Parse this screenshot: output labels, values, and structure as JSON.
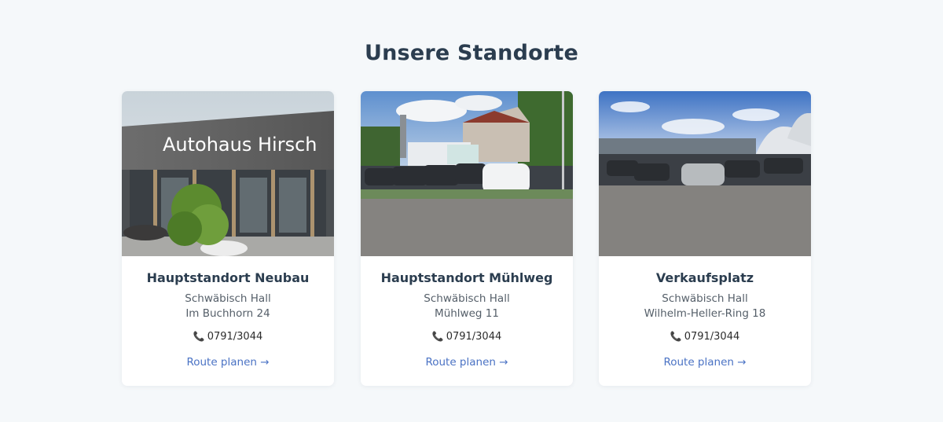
{
  "section": {
    "title": "Unsere Standorte"
  },
  "locations": [
    {
      "title": "Hauptstandort Neubau",
      "city": "Schwäbisch Hall",
      "address": "Im Buchhorn 24",
      "phone": "0791/3044",
      "link_label": "Route planen →",
      "image_sign": "Autohaus Hirsch"
    },
    {
      "title": "Hauptstandort Mühlweg",
      "city": "Schwäbisch Hall",
      "address": "Mühlweg 11",
      "phone": "0791/3044",
      "link_label": "Route planen →"
    },
    {
      "title": "Verkaufsplatz",
      "city": "Schwäbisch Hall",
      "address": "Wilhelm-Heller-Ring 18",
      "phone": "0791/3044",
      "link_label": "Route planen →"
    }
  ],
  "icons": {
    "phone": "phone-icon"
  },
  "colors": {
    "background": "#f5f8fa",
    "title": "#2b3d4f",
    "link": "#4a72c4"
  }
}
